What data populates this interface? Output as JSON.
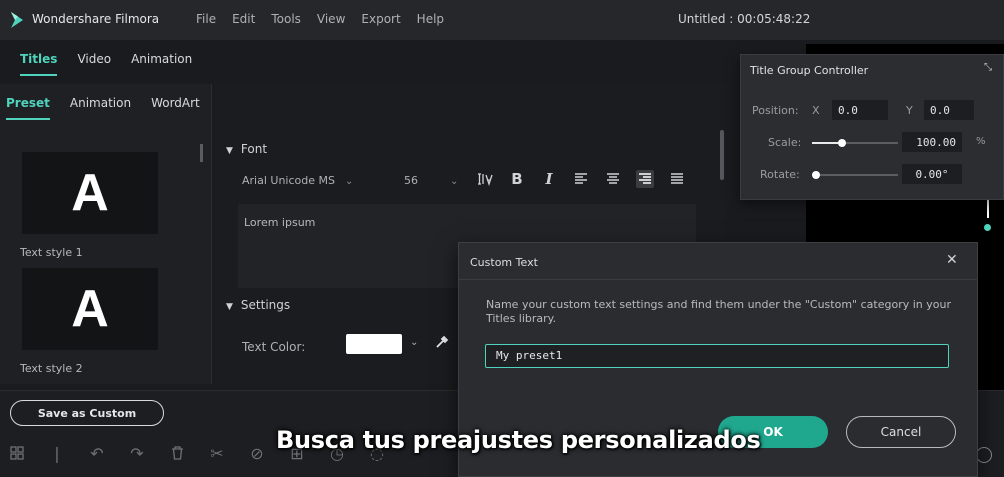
{
  "app": {
    "name": "Wondershare Filmora",
    "menu": [
      "File",
      "Edit",
      "Tools",
      "View",
      "Export",
      "Help"
    ],
    "project_title": "Untitled : 00:05:48:22"
  },
  "main_tabs": [
    "Titles",
    "Video",
    "Animation"
  ],
  "sub_tabs": [
    "Preset",
    "Animation",
    "WordArt"
  ],
  "presets": [
    {
      "glyph": "A",
      "label": "Text style 1"
    },
    {
      "glyph": "A",
      "label": "Text style 2"
    }
  ],
  "font_section": {
    "heading": "Font",
    "font_family": "Arial Unicode MS",
    "font_size": "56",
    "text_value": "Lorem ipsum"
  },
  "settings_section": {
    "heading": "Settings",
    "text_color_label": "Text Color:",
    "text_color": "#ffffff"
  },
  "save_custom_label": "Save as Custom",
  "title_group_controller": {
    "title": "Title Group Controller",
    "position_label": "Position:",
    "x_label": "X",
    "x_value": "0.0",
    "y_label": "Y",
    "y_value": "0.0",
    "scale_label": "Scale:",
    "scale_value": "100.00",
    "scale_unit": "%",
    "scale_level": 0.35,
    "rotate_label": "Rotate:",
    "rotate_value": "0.00°",
    "rotate_level": 0.0
  },
  "dialog": {
    "title": "Custom Text",
    "description": "Name your custom text settings and find them under the \"Custom\" category in your Titles library.",
    "input_value": "My preset1",
    "ok_label": "OK",
    "cancel_label": "Cancel"
  },
  "caption": "Busca tus preajustes personalizados",
  "colors": {
    "accent": "#4fd3bc",
    "ok_button": "#1fa88e"
  }
}
